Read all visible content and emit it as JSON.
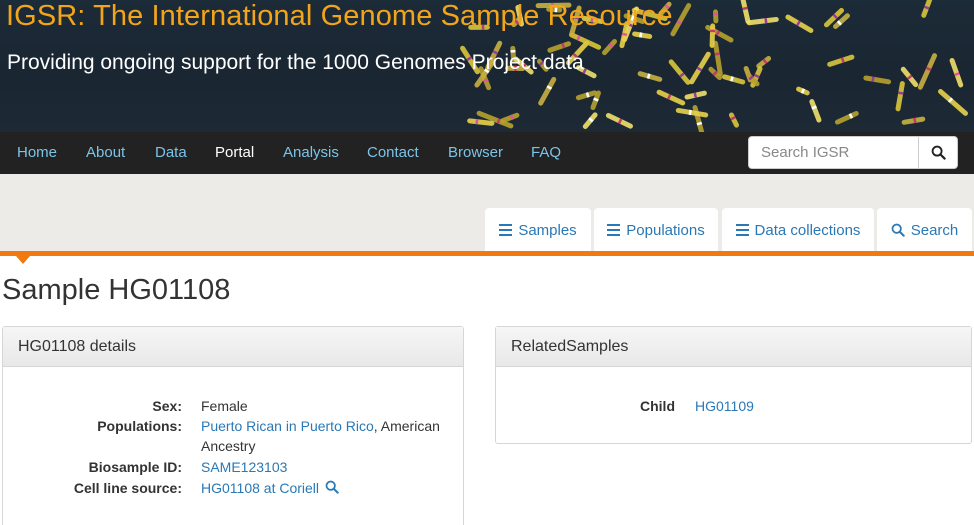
{
  "banner": {
    "title": "IGSR: The International Genome Sample Resource",
    "subtitle": "Providing ongoing support for the 1000 Genomes Project data"
  },
  "nav": {
    "items": [
      {
        "label": "Home",
        "active": false
      },
      {
        "label": "About",
        "active": false
      },
      {
        "label": "Data",
        "active": false
      },
      {
        "label": "Portal",
        "active": true
      },
      {
        "label": "Analysis",
        "active": false
      },
      {
        "label": "Contact",
        "active": false
      },
      {
        "label": "Browser",
        "active": false
      },
      {
        "label": "FAQ",
        "active": false
      }
    ],
    "search_placeholder": "Search IGSR"
  },
  "tabs": [
    {
      "label": "Samples",
      "icon": "menu-icon"
    },
    {
      "label": "Populations",
      "icon": "menu-icon"
    },
    {
      "label": "Data collections",
      "icon": "menu-icon"
    },
    {
      "label": "Search",
      "icon": "search-icon"
    }
  ],
  "page": {
    "title": "Sample HG01108"
  },
  "details_panel": {
    "title": "HG01108 details",
    "sex_label": "Sex:",
    "sex_value": "Female",
    "populations_label": "Populations:",
    "population_link": "Puerto Rican in Puerto Rico",
    "population_rest_line1": ", American",
    "population_rest_line2": "Ancestry",
    "biosample_label": "Biosample ID:",
    "biosample_value": "SAME123103",
    "cellline_label": "Cell line source:",
    "cellline_value": "HG01108 at Coriell"
  },
  "related_panel": {
    "title": "RelatedSamples",
    "relation_label": "Child",
    "relation_value": "HG01109"
  },
  "colors": {
    "banner_title": "#f2a51a",
    "nav_link": "#7bc4e8",
    "link": "#2a78b5",
    "accent": "#f07a0f"
  }
}
